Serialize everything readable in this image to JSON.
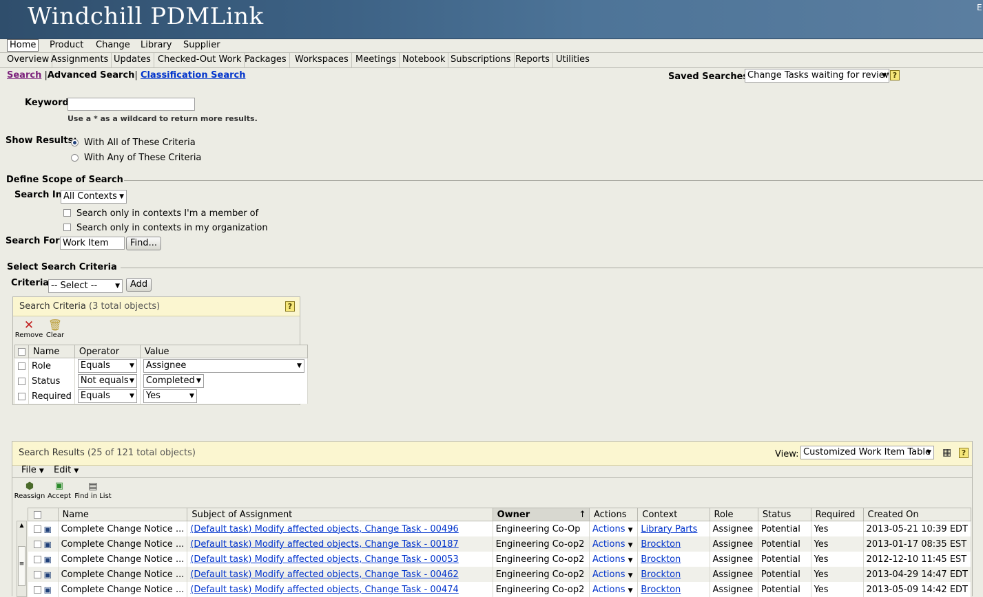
{
  "app": {
    "title": "Windchill PDMLink",
    "corner_text": "E"
  },
  "nav": {
    "tabs": [
      "Home",
      "Product",
      "Change",
      "Library",
      "Supplier"
    ],
    "subtabs": [
      "Overview",
      "Assignments",
      "Updates",
      "Checked-Out Work",
      "Packages",
      "Workspaces",
      "Meetings",
      "Notebook",
      "Subscriptions",
      "Reports",
      "Utilities"
    ]
  },
  "search_nav": {
    "search": "Search",
    "advanced": "Advanced Search",
    "classification": "Classification Search",
    "sep": "|"
  },
  "saved_searches": {
    "label": "Saved Searches:",
    "value": "Change Tasks waiting for review",
    "help": "?"
  },
  "keyword": {
    "label": "Keyword:",
    "value": "",
    "hint": "Use a * as a wildcard to return more results."
  },
  "show_results": {
    "label": "Show Results:",
    "opt_all": "With All of These Criteria",
    "opt_any": "With Any of These Criteria"
  },
  "scope": {
    "heading": "Define Scope of Search",
    "search_in_label": "Search In:",
    "search_in_value": "All Contexts",
    "member_cb": "Search only in contexts I'm a member of",
    "org_cb": "Search only in contexts in my organization",
    "search_for_label": "Search For:",
    "search_for_value": "Work Item",
    "find_btn": "Find..."
  },
  "criteria": {
    "heading": "Select Search Criteria",
    "label": "Criteria:",
    "select_value": "-- Select --",
    "add_btn": "Add",
    "panel_title": "Search Criteria",
    "panel_count": "(3 total objects)",
    "help": "?",
    "remove": "Remove",
    "clear": "Clear",
    "headers": [
      "Name",
      "Operator",
      "Value"
    ],
    "rows": [
      {
        "name": "Role",
        "op": "Equals",
        "value": "Assignee"
      },
      {
        "name": "Status",
        "op": "Not equals",
        "value": "Completed"
      },
      {
        "name": "Required",
        "op": "Equals",
        "value": "Yes"
      }
    ]
  },
  "results": {
    "title": "Search Results",
    "count": "(25 of 121 total objects)",
    "view_label": "View:",
    "view_value": "Customized Work Item Table",
    "help": "?",
    "menu_file": "File",
    "menu_edit": "Edit",
    "tool_reassign": "Reassign",
    "tool_accept": "Accept",
    "tool_find": "Find in List",
    "headers": [
      "Name",
      "Subject of Assignment",
      "Owner",
      "Actions",
      "Context",
      "Role",
      "Status",
      "Required",
      "Created On"
    ],
    "sort_marker": "↑",
    "rows": [
      {
        "name": "Complete Change Notice",
        "ellipsis": "...",
        "subject": "(Default task) Modify affected objects, Change Task - 00496",
        "owner": "Engineering Co-Op",
        "actions": "Actions",
        "context": "Library Parts",
        "role": "Assignee",
        "status": "Potential",
        "required": "Yes",
        "created": "2013-05-21 10:39 EDT"
      },
      {
        "name": "Complete Change Notice",
        "ellipsis": "...",
        "subject": "(Default task) Modify affected objects, Change Task - 00187",
        "owner": "Engineering Co-op2",
        "actions": "Actions",
        "context": "Brockton",
        "role": "Assignee",
        "status": "Potential",
        "required": "Yes",
        "created": "2013-01-17 08:35 EST"
      },
      {
        "name": "Complete Change Notice",
        "ellipsis": "...",
        "subject": "(Default task) Modify affected objects, Change Task - 00053",
        "owner": "Engineering Co-op2",
        "actions": "Actions",
        "context": "Brockton",
        "role": "Assignee",
        "status": "Potential",
        "required": "Yes",
        "created": "2012-12-10 11:45 EST"
      },
      {
        "name": "Complete Change Notice",
        "ellipsis": "...",
        "subject": "(Default task) Modify affected objects, Change Task - 00462",
        "owner": "Engineering Co-op2",
        "actions": "Actions",
        "context": "Brockton",
        "role": "Assignee",
        "status": "Potential",
        "required": "Yes",
        "created": "2013-04-29 14:47 EDT"
      },
      {
        "name": "Complete Change Notice",
        "ellipsis": "...",
        "subject": "(Default task) Modify affected objects, Change Task - 00474",
        "owner": "Engineering Co-op2",
        "actions": "Actions",
        "context": "Brockton",
        "role": "Assignee",
        "status": "Potential",
        "required": "Yes",
        "created": "2013-05-09 14:42 EDT"
      }
    ]
  }
}
